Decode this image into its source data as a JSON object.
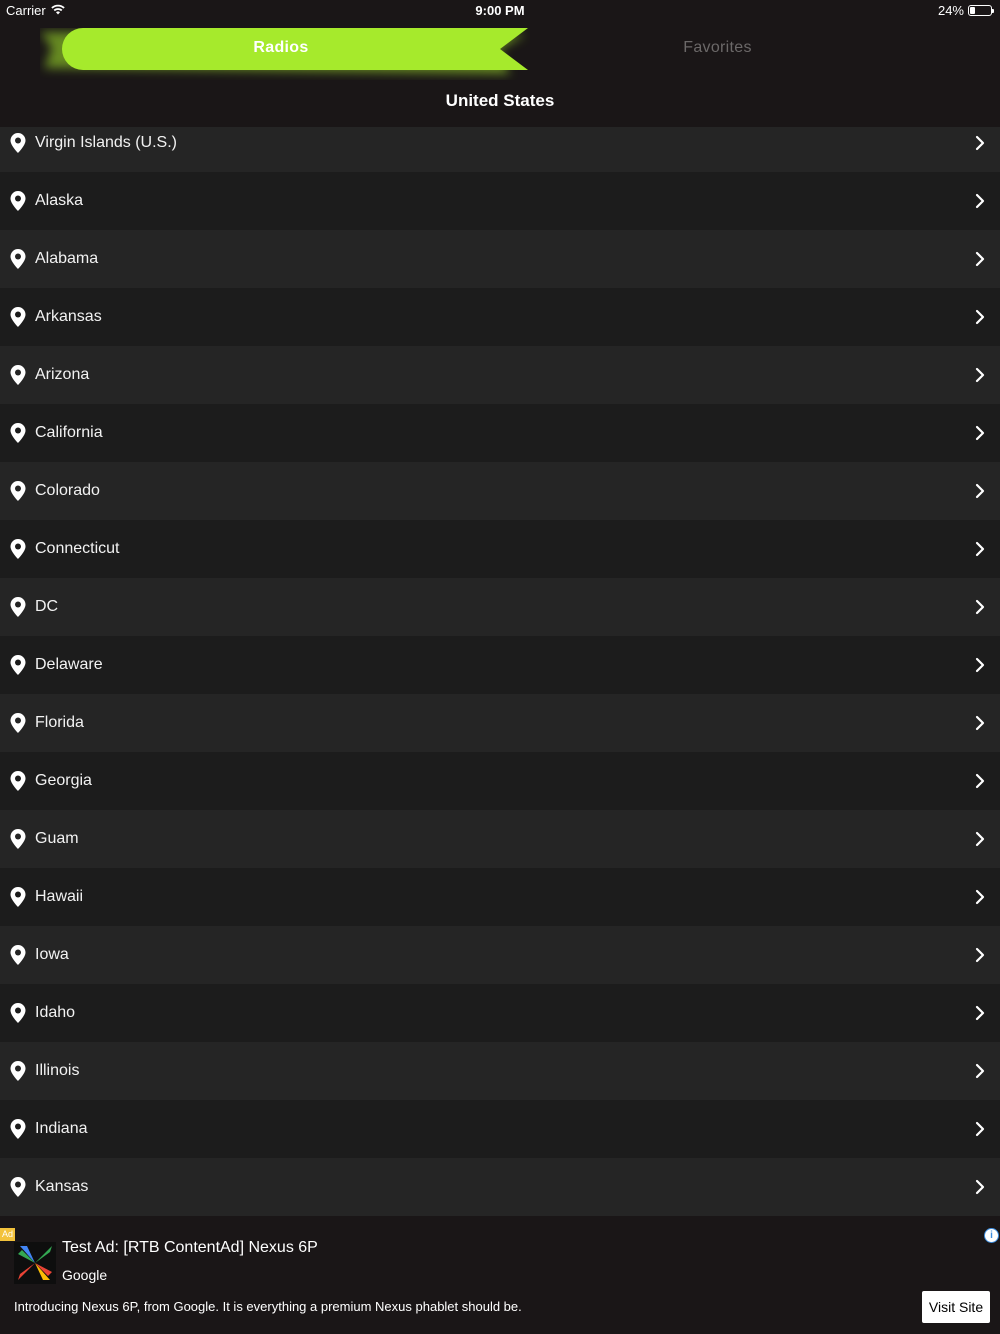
{
  "status_bar": {
    "carrier": "Carrier",
    "time": "9:00 PM",
    "battery_percent": "24%",
    "battery_level": 0.24
  },
  "tabs": {
    "radios": "Radios",
    "favorites": "Favorites",
    "active": "radios",
    "active_color": "#a6ea2c"
  },
  "header": {
    "title": "United States"
  },
  "states": [
    "Virgin Islands (U.S.)",
    "Alaska",
    "Alabama",
    "Arkansas",
    "Arizona",
    "California",
    "Colorado",
    "Connecticut",
    "DC",
    "Delaware",
    "Florida",
    "Georgia",
    "Guam",
    "Hawaii",
    "Iowa",
    "Idaho",
    "Illinois",
    "Indiana",
    "Kansas"
  ],
  "icons": {
    "row_leading": "location-pin-icon",
    "row_trailing": "chevron-right-icon"
  },
  "ad": {
    "badge": "Ad",
    "title": "Test Ad: [RTB ContentAd] Nexus 6P",
    "advertiser": "Google",
    "body": "Introducing Nexus 6P, from Google. It is everything a premium Nexus phablet should be.",
    "cta": "Visit Site",
    "info": "i"
  }
}
